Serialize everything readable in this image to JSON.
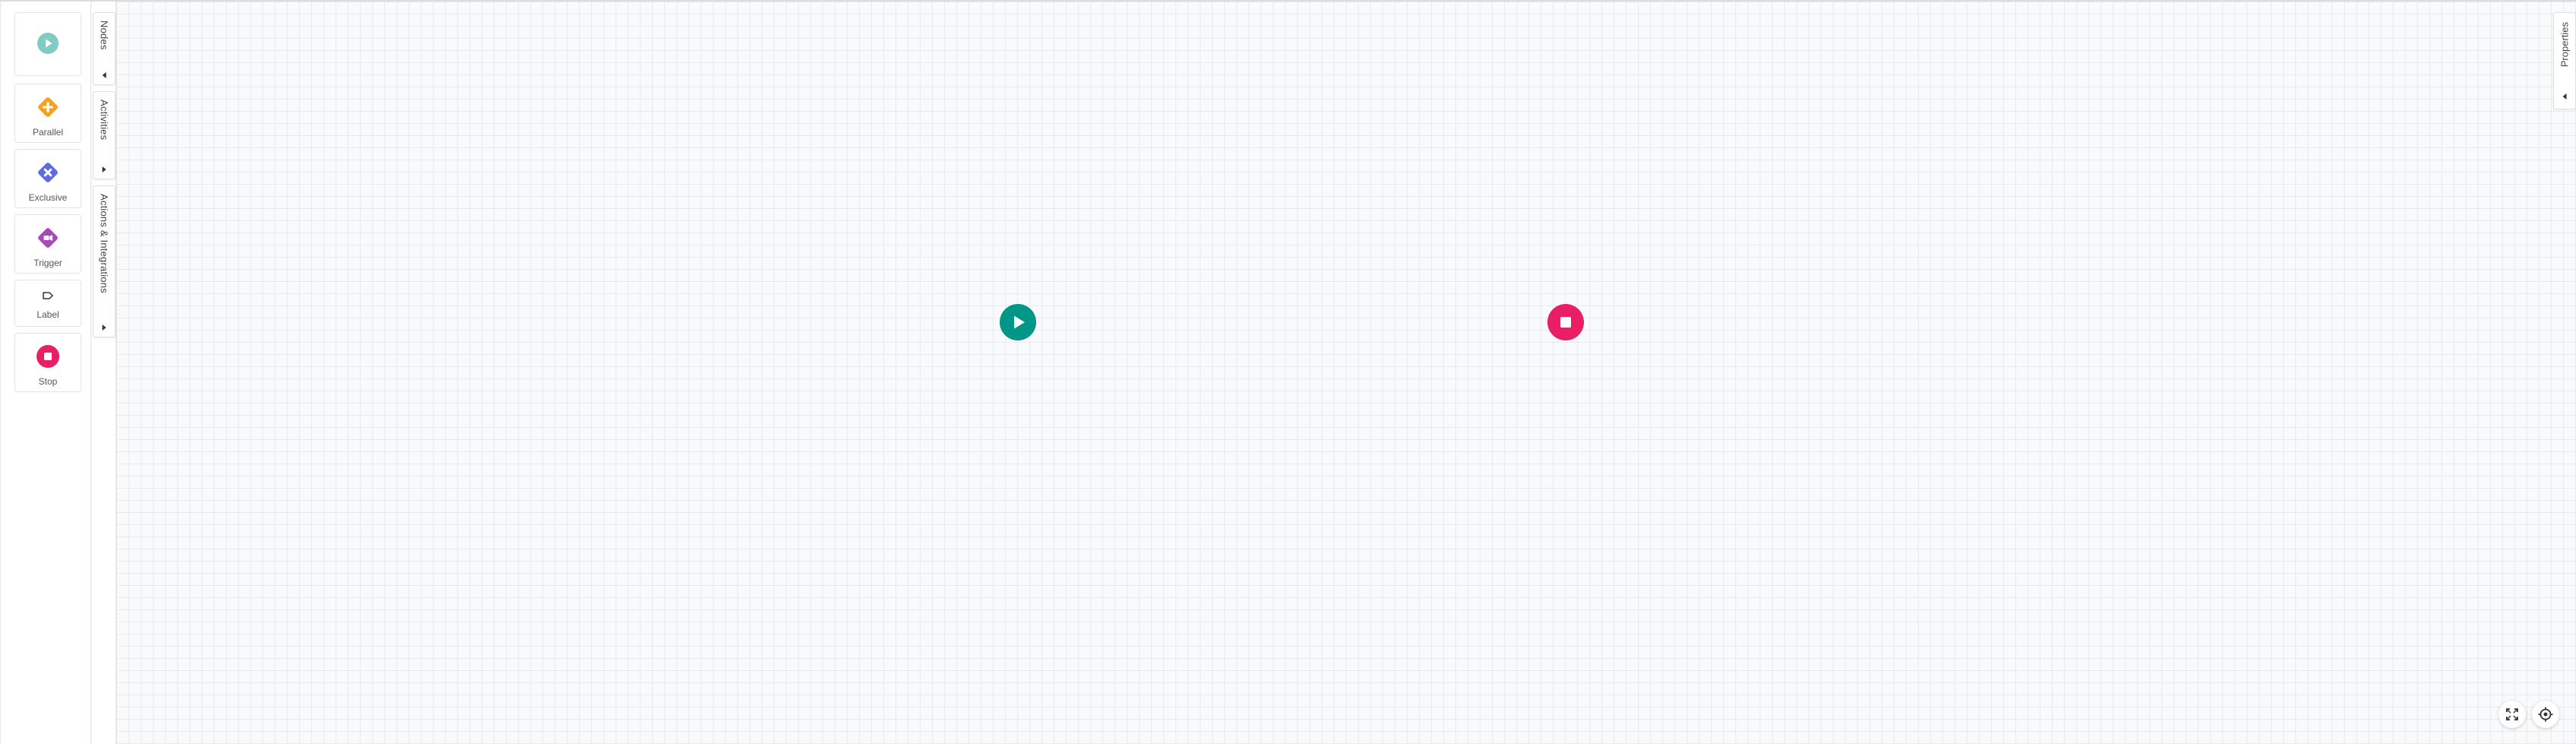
{
  "palette": {
    "items": [
      {
        "label": "",
        "icon": "start-icon",
        "color": "#80CBC4"
      },
      {
        "label": "Parallel",
        "icon": "parallel-icon",
        "color": "#F6A21E"
      },
      {
        "label": "Exclusive",
        "icon": "exclusive-icon",
        "color": "#5B6BE0"
      },
      {
        "label": "Trigger",
        "icon": "trigger-icon",
        "color": "#AB47BC"
      },
      {
        "label": "Label",
        "icon": "label-icon",
        "color": "#333333"
      },
      {
        "label": "Stop",
        "icon": "stop-icon",
        "color": "#E91E63"
      }
    ]
  },
  "tabs": {
    "nodes": "Nodes",
    "activities": "Activities",
    "actions": "Actions & Integrations",
    "properties": "Properties"
  },
  "canvas": {
    "start_color": "#009688",
    "stop_color": "#E91E63"
  },
  "controls": {
    "fit": "fit-screen-icon",
    "center": "center-focus-icon"
  }
}
